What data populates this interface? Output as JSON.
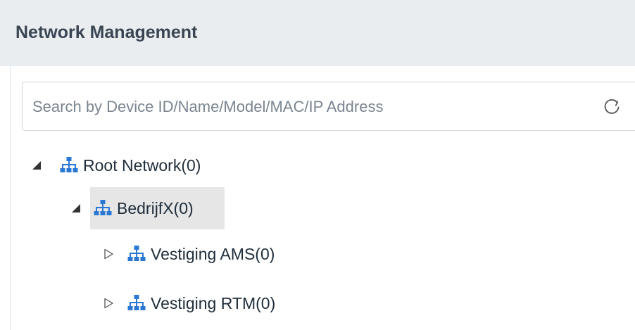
{
  "header": {
    "title": "Network Management"
  },
  "search": {
    "placeholder": "Search by Device ID/Name/Model/MAC/IP Address",
    "value": "",
    "refresh_icon": "refresh-icon"
  },
  "tree": {
    "root": {
      "label": "Root Network(0)",
      "expanded": true,
      "icon": "network-icon"
    },
    "company": {
      "label": "BedrijfX(0)",
      "expanded": true,
      "selected": true,
      "icon": "network-icon"
    },
    "branches": [
      {
        "label": "Vestiging AMS(0)",
        "expanded": false,
        "icon": "network-icon"
      },
      {
        "label": "Vestiging RTM(0)",
        "expanded": false,
        "icon": "network-icon"
      }
    ]
  },
  "colors": {
    "accent": "#2a78d4",
    "header_bg": "#e9edf0",
    "selected_bg": "#e6e6e6"
  }
}
